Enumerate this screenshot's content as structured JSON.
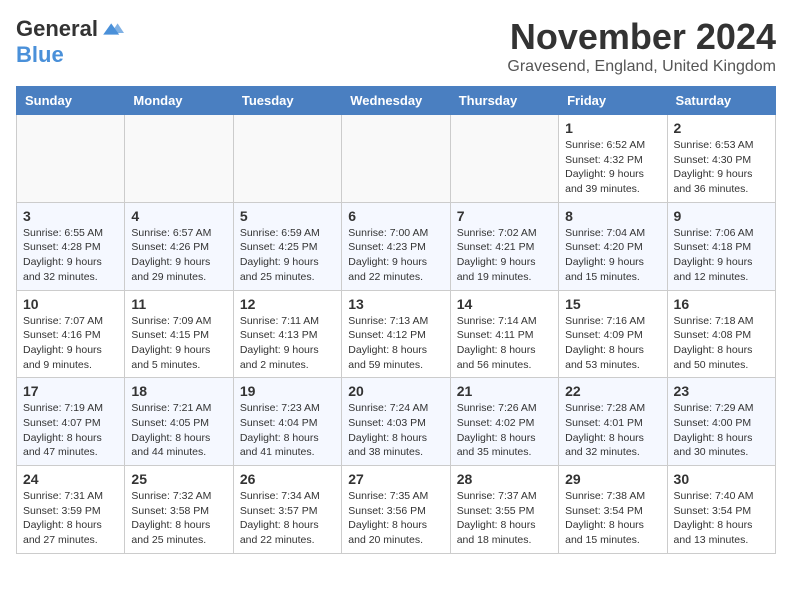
{
  "header": {
    "logo_general": "General",
    "logo_blue": "Blue",
    "month_title": "November 2024",
    "location": "Gravesend, England, United Kingdom"
  },
  "days_of_week": [
    "Sunday",
    "Monday",
    "Tuesday",
    "Wednesday",
    "Thursday",
    "Friday",
    "Saturday"
  ],
  "weeks": [
    [
      {
        "day": "",
        "detail": ""
      },
      {
        "day": "",
        "detail": ""
      },
      {
        "day": "",
        "detail": ""
      },
      {
        "day": "",
        "detail": ""
      },
      {
        "day": "",
        "detail": ""
      },
      {
        "day": "1",
        "detail": "Sunrise: 6:52 AM\nSunset: 4:32 PM\nDaylight: 9 hours\nand 39 minutes."
      },
      {
        "day": "2",
        "detail": "Sunrise: 6:53 AM\nSunset: 4:30 PM\nDaylight: 9 hours\nand 36 minutes."
      }
    ],
    [
      {
        "day": "3",
        "detail": "Sunrise: 6:55 AM\nSunset: 4:28 PM\nDaylight: 9 hours\nand 32 minutes."
      },
      {
        "day": "4",
        "detail": "Sunrise: 6:57 AM\nSunset: 4:26 PM\nDaylight: 9 hours\nand 29 minutes."
      },
      {
        "day": "5",
        "detail": "Sunrise: 6:59 AM\nSunset: 4:25 PM\nDaylight: 9 hours\nand 25 minutes."
      },
      {
        "day": "6",
        "detail": "Sunrise: 7:00 AM\nSunset: 4:23 PM\nDaylight: 9 hours\nand 22 minutes."
      },
      {
        "day": "7",
        "detail": "Sunrise: 7:02 AM\nSunset: 4:21 PM\nDaylight: 9 hours\nand 19 minutes."
      },
      {
        "day": "8",
        "detail": "Sunrise: 7:04 AM\nSunset: 4:20 PM\nDaylight: 9 hours\nand 15 minutes."
      },
      {
        "day": "9",
        "detail": "Sunrise: 7:06 AM\nSunset: 4:18 PM\nDaylight: 9 hours\nand 12 minutes."
      }
    ],
    [
      {
        "day": "10",
        "detail": "Sunrise: 7:07 AM\nSunset: 4:16 PM\nDaylight: 9 hours\nand 9 minutes."
      },
      {
        "day": "11",
        "detail": "Sunrise: 7:09 AM\nSunset: 4:15 PM\nDaylight: 9 hours\nand 5 minutes."
      },
      {
        "day": "12",
        "detail": "Sunrise: 7:11 AM\nSunset: 4:13 PM\nDaylight: 9 hours\nand 2 minutes."
      },
      {
        "day": "13",
        "detail": "Sunrise: 7:13 AM\nSunset: 4:12 PM\nDaylight: 8 hours\nand 59 minutes."
      },
      {
        "day": "14",
        "detail": "Sunrise: 7:14 AM\nSunset: 4:11 PM\nDaylight: 8 hours\nand 56 minutes."
      },
      {
        "day": "15",
        "detail": "Sunrise: 7:16 AM\nSunset: 4:09 PM\nDaylight: 8 hours\nand 53 minutes."
      },
      {
        "day": "16",
        "detail": "Sunrise: 7:18 AM\nSunset: 4:08 PM\nDaylight: 8 hours\nand 50 minutes."
      }
    ],
    [
      {
        "day": "17",
        "detail": "Sunrise: 7:19 AM\nSunset: 4:07 PM\nDaylight: 8 hours\nand 47 minutes."
      },
      {
        "day": "18",
        "detail": "Sunrise: 7:21 AM\nSunset: 4:05 PM\nDaylight: 8 hours\nand 44 minutes."
      },
      {
        "day": "19",
        "detail": "Sunrise: 7:23 AM\nSunset: 4:04 PM\nDaylight: 8 hours\nand 41 minutes."
      },
      {
        "day": "20",
        "detail": "Sunrise: 7:24 AM\nSunset: 4:03 PM\nDaylight: 8 hours\nand 38 minutes."
      },
      {
        "day": "21",
        "detail": "Sunrise: 7:26 AM\nSunset: 4:02 PM\nDaylight: 8 hours\nand 35 minutes."
      },
      {
        "day": "22",
        "detail": "Sunrise: 7:28 AM\nSunset: 4:01 PM\nDaylight: 8 hours\nand 32 minutes."
      },
      {
        "day": "23",
        "detail": "Sunrise: 7:29 AM\nSunset: 4:00 PM\nDaylight: 8 hours\nand 30 minutes."
      }
    ],
    [
      {
        "day": "24",
        "detail": "Sunrise: 7:31 AM\nSunset: 3:59 PM\nDaylight: 8 hours\nand 27 minutes."
      },
      {
        "day": "25",
        "detail": "Sunrise: 7:32 AM\nSunset: 3:58 PM\nDaylight: 8 hours\nand 25 minutes."
      },
      {
        "day": "26",
        "detail": "Sunrise: 7:34 AM\nSunset: 3:57 PM\nDaylight: 8 hours\nand 22 minutes."
      },
      {
        "day": "27",
        "detail": "Sunrise: 7:35 AM\nSunset: 3:56 PM\nDaylight: 8 hours\nand 20 minutes."
      },
      {
        "day": "28",
        "detail": "Sunrise: 7:37 AM\nSunset: 3:55 PM\nDaylight: 8 hours\nand 18 minutes."
      },
      {
        "day": "29",
        "detail": "Sunrise: 7:38 AM\nSunset: 3:54 PM\nDaylight: 8 hours\nand 15 minutes."
      },
      {
        "day": "30",
        "detail": "Sunrise: 7:40 AM\nSunset: 3:54 PM\nDaylight: 8 hours\nand 13 minutes."
      }
    ]
  ]
}
